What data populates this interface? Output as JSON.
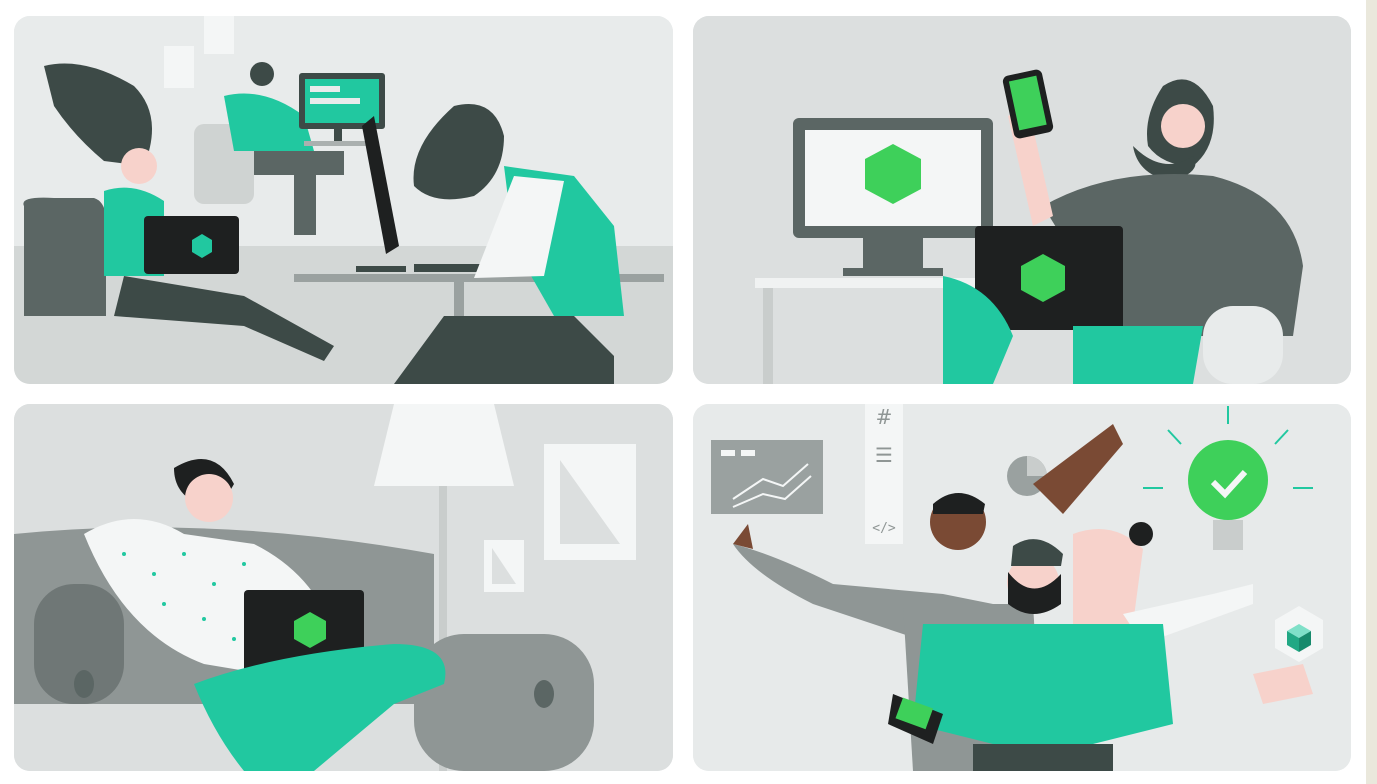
{
  "colors": {
    "accent_green": "#21c8a0",
    "bright_green": "#3ed05a",
    "dark_gray": "#3d4a47",
    "mid_gray": "#8f9695",
    "light_gray": "#dcdfdf",
    "laptop_black": "#1e2020",
    "skin_light": "#f7d2cb",
    "skin_dark": "#7a4a34",
    "page_bg": "#eae8dc"
  },
  "panels": [
    {
      "scene": "office-team-working"
    },
    {
      "scene": "developer-with-phone-and-laptop"
    },
    {
      "scene": "person-relaxing-on-couch"
    },
    {
      "scene": "team-celebrating"
    }
  ],
  "icons": {
    "hash_symbol": "#",
    "list_symbol": "☰",
    "code_symbol": "</>"
  }
}
